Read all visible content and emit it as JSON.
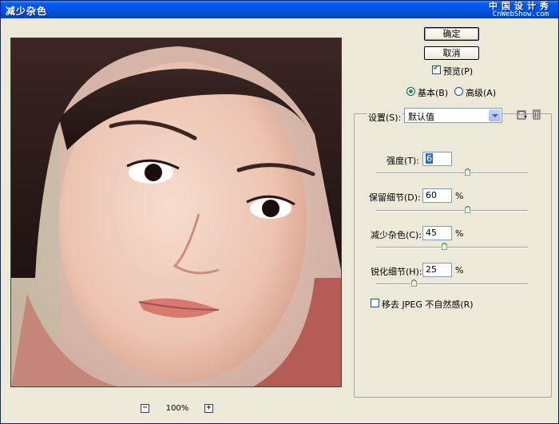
{
  "window": {
    "title": "减少杂色"
  },
  "watermark": {
    "line1": "中国设计秀",
    "line2": "CnWebShow.com"
  },
  "buttons": {
    "ok": "确定",
    "cancel": "取消"
  },
  "preview_check": {
    "label": "预览(P)",
    "checked": true
  },
  "mode": {
    "basic": "基本(B)",
    "advanced": "高级(A)",
    "selected": "basic"
  },
  "settings": {
    "label": "设置(S):",
    "value": "默认值"
  },
  "controls": [
    {
      "label": "强度(T):",
      "value": "6",
      "unit": "",
      "slider_fraction": 0.6
    },
    {
      "label": "保留细节(D):",
      "value": "60",
      "unit": "%",
      "slider_fraction": 0.6
    },
    {
      "label": "减少杂色(C):",
      "value": "45",
      "unit": "%",
      "slider_fraction": 0.45
    },
    {
      "label": "锐化细节(H):",
      "value": "25",
      "unit": "%",
      "slider_fraction": 0.25
    }
  ],
  "jpeg_check": {
    "label": "移去 JPEG 不自然感(R)",
    "checked": false
  },
  "zoom": {
    "level": "100%",
    "minus": "−",
    "plus": "+"
  },
  "icons": [
    "save-settings-icon",
    "delete-settings-icon",
    "zoom-out-icon",
    "zoom-in-icon"
  ]
}
